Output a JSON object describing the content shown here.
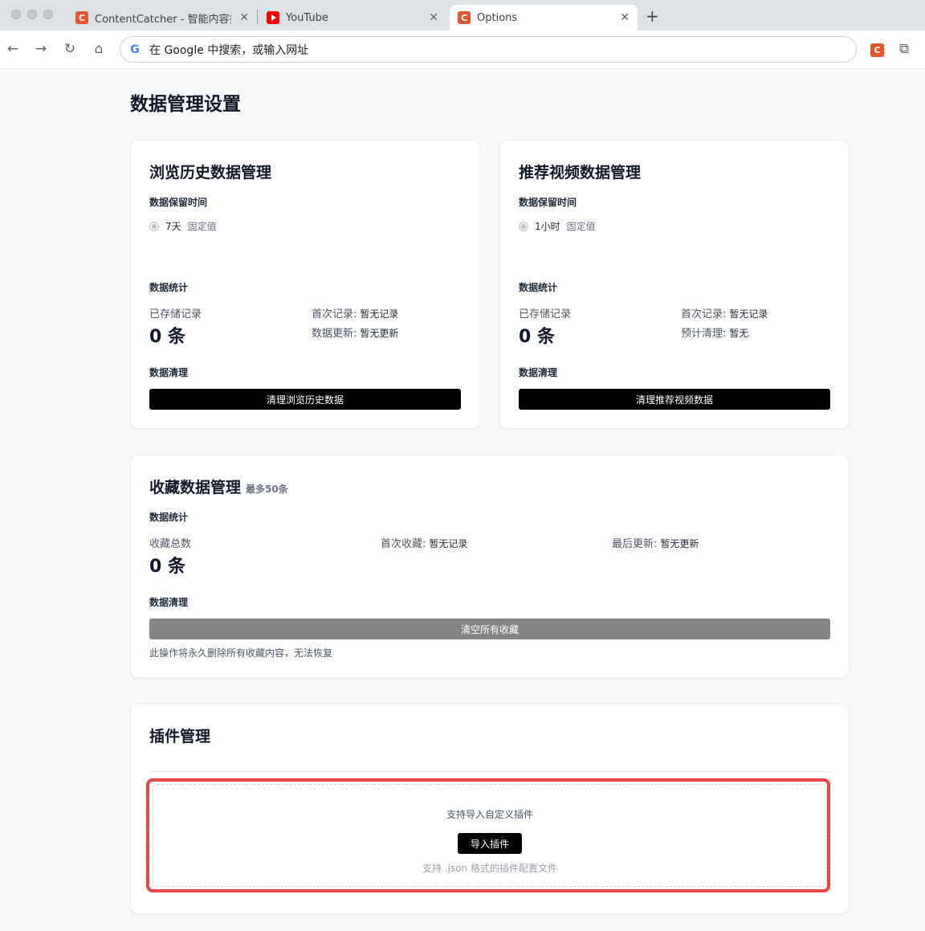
{
  "browser": {
    "tabs": [
      {
        "title": "ContentCatcher - 智能内容捕手",
        "close": "✕"
      },
      {
        "title": "YouTube",
        "close": "✕"
      },
      {
        "title": "Options",
        "close": "✕"
      }
    ],
    "new_tab": "+",
    "omnibox_text": "在 Google 中搜索，或输入网址"
  },
  "page": {
    "title": "数据管理设置"
  },
  "history_card": {
    "title": "浏览历史数据管理",
    "retention_label": "数据保留时间",
    "retention_value": "7天",
    "retention_note": "固定值",
    "stats_label": "数据统计",
    "stored_label": "已存储记录",
    "stored_value": "0 条",
    "first_label": "首次记录:",
    "first_value": "暂无记录",
    "update_label": "数据更新:",
    "update_value": "暂无更新",
    "cleanup_label": "数据清理",
    "cleanup_button": "清理浏览历史数据"
  },
  "recommend_card": {
    "title": "推荐视频数据管理",
    "retention_label": "数据保留时间",
    "retention_value": "1小时",
    "retention_note": "固定值",
    "stats_label": "数据统计",
    "stored_label": "已存储记录",
    "stored_value": "0 条",
    "first_label": "首次记录:",
    "first_value": "暂无记录",
    "planned_label": "预计清理:",
    "planned_value": "暂无",
    "cleanup_label": "数据清理",
    "cleanup_button": "清理推荐视频数据"
  },
  "favorites_card": {
    "title": "收藏数据管理",
    "badge": "最多50条",
    "stats_label": "数据统计",
    "total_label": "收藏总数",
    "total_value": "0 条",
    "first_label": "首次收藏:",
    "first_value": "暂无记录",
    "last_label": "最后更新:",
    "last_value": "暂无更新",
    "cleanup_label": "数据清理",
    "clear_button": "清空所有收藏",
    "warning": "此操作将永久删除所有收藏内容，无法恢复"
  },
  "plugin_card": {
    "title": "插件管理",
    "drop_text": "支持导入自定义插件",
    "import_button": "导入插件",
    "hint": "支持 .json 格式的插件配置文件"
  },
  "colors": {
    "highlight": "#e64848",
    "primary_button": "#000000",
    "disabled_button": "#858585"
  }
}
